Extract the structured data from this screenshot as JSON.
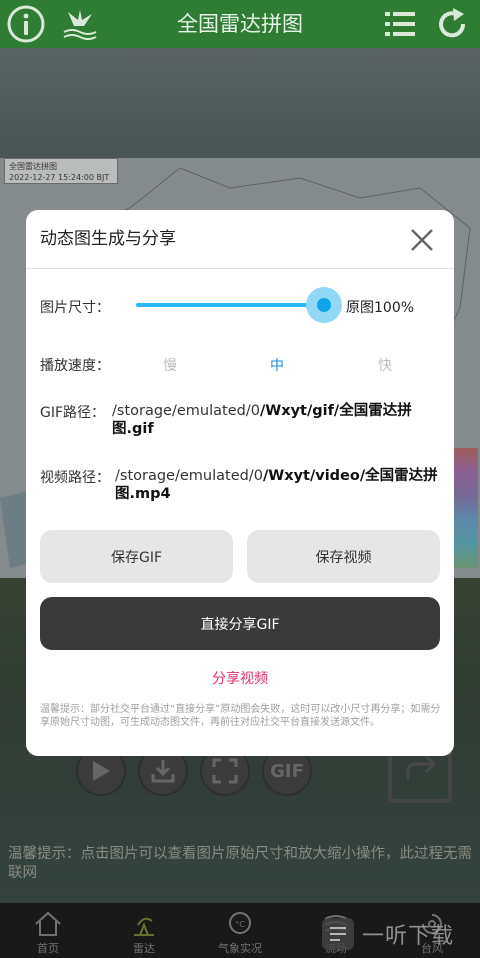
{
  "header": {
    "title": "全国雷达拼图",
    "icons": [
      "info-icon",
      "crane-logo-icon",
      "list-icon",
      "refresh-icon"
    ]
  },
  "radar": {
    "caption_title": "全国雷达拼图",
    "caption_time": "2022-12-27 15:24:00 BJT"
  },
  "dialog": {
    "title": "动态图生成与分享",
    "size_label": "图片尺寸：",
    "size_value": "原图100%",
    "size_percent": 100,
    "speed_label": "播放速度：",
    "speed_options": [
      "慢",
      "中",
      "快"
    ],
    "speed_selected": "中",
    "gif_path_label": "GIF路径：",
    "gif_path_prefix": "/storage/emulated/0",
    "gif_path_bold": "/Wxyt/gif/全国雷达拼",
    "gif_path_line2": "图.gif",
    "video_path_label": "视频路径：",
    "video_path_prefix": "/storage/emulated/0",
    "video_path_bold": "/Wxyt/video/全国雷达拼",
    "video_path_line2": "图.mp4",
    "save_gif": "保存GIF",
    "save_video": "保存视频",
    "share_gif": "直接分享GIF",
    "share_video": "分享视频",
    "note": "温馨提示：部分社交平台通过“直接分享”原动图会失败，这时可以改小尺寸再分享；如需分享原始尺寸动图，可生成动态图文件，再前往对应社交平台直接发送源文件。"
  },
  "controls": {
    "gif_button": "GIF"
  },
  "tip": "温馨提示：点击图片可以查看图片原始尺寸和放大缩小操作，此过程无需联网",
  "nav": {
    "items": [
      {
        "label": "首页"
      },
      {
        "label": "雷达"
      },
      {
        "label": "气象实况"
      },
      {
        "label": "流场"
      },
      {
        "label": "台风"
      }
    ]
  },
  "watermark": "一听下载"
}
